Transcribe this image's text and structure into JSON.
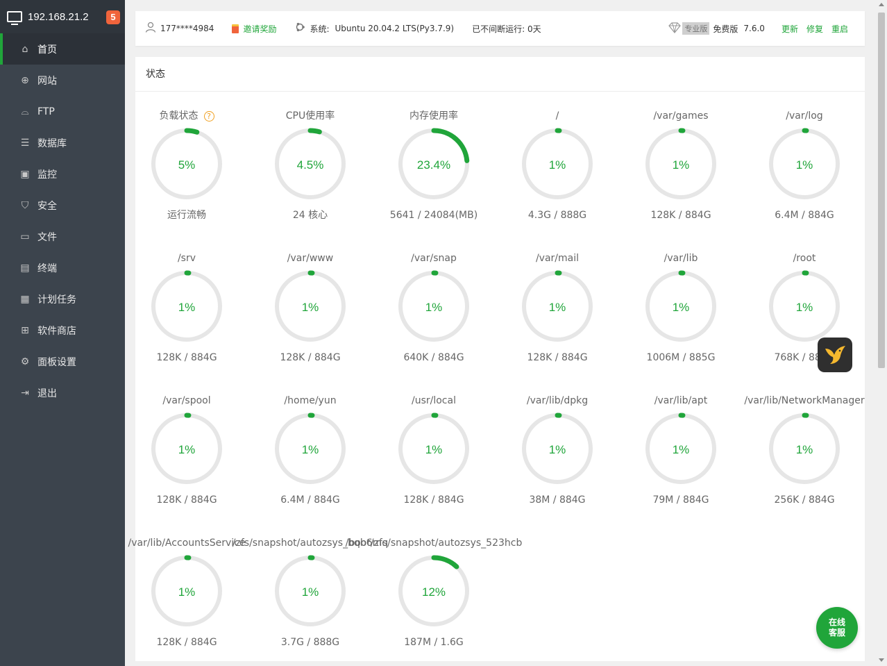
{
  "sidebar": {
    "host": "192.168.21.2",
    "badge": "5",
    "items": [
      {
        "label": "首页",
        "icon": "home-icon",
        "glyph": "⌂",
        "active": true
      },
      {
        "label": "网站",
        "icon": "globe-icon",
        "glyph": "⊕",
        "active": false
      },
      {
        "label": "FTP",
        "icon": "ftp-icon",
        "glyph": "⌓",
        "active": false
      },
      {
        "label": "数据库",
        "icon": "database-icon",
        "glyph": "☰",
        "active": false
      },
      {
        "label": "监控",
        "icon": "monitor-icon",
        "glyph": "▣",
        "active": false
      },
      {
        "label": "安全",
        "icon": "shield-icon",
        "glyph": "⛉",
        "active": false
      },
      {
        "label": "文件",
        "icon": "folder-icon",
        "glyph": "▭",
        "active": false
      },
      {
        "label": "终端",
        "icon": "terminal-icon",
        "glyph": "▤",
        "active": false
      },
      {
        "label": "计划任务",
        "icon": "calendar-icon",
        "glyph": "▦",
        "active": false
      },
      {
        "label": "软件商店",
        "icon": "apps-icon",
        "glyph": "⊞",
        "active": false
      },
      {
        "label": "面板设置",
        "icon": "gear-icon",
        "glyph": "⚙",
        "active": false
      },
      {
        "label": "退出",
        "icon": "logout-icon",
        "glyph": "⇥",
        "active": false
      }
    ]
  },
  "topbar": {
    "user": "177****4984",
    "invite": "邀请奖励",
    "system_label": "系统:",
    "system_value": "Ubuntu 20.04.2 LTS(Py3.7.9)",
    "uptime": "已不间断运行: 0天",
    "pro_tag": "专业版",
    "free_label": "免费版",
    "version": "7.6.0",
    "update": "更新",
    "repair": "修复",
    "restart": "重启"
  },
  "status": {
    "title": "状态",
    "help": "?"
  },
  "gauges": [
    {
      "title": "负载状态",
      "value": "5%",
      "percent": 5,
      "sub": "运行流畅",
      "help": true
    },
    {
      "title": "CPU使用率",
      "value": "4.5%",
      "percent": 4.5,
      "sub": "24 核心"
    },
    {
      "title": "内存使用率",
      "value": "23.4%",
      "percent": 23.4,
      "sub": "5641 / 24084(MB)"
    },
    {
      "title": "/",
      "value": "1%",
      "percent": 1,
      "sub": "4.3G / 888G"
    },
    {
      "title": "/var/games",
      "value": "1%",
      "percent": 1,
      "sub": "128K / 884G"
    },
    {
      "title": "/var/log",
      "value": "1%",
      "percent": 1,
      "sub": "6.4M / 884G"
    },
    {
      "title": "/srv",
      "value": "1%",
      "percent": 1,
      "sub": "128K / 884G"
    },
    {
      "title": "/var/www",
      "value": "1%",
      "percent": 1,
      "sub": "128K / 884G"
    },
    {
      "title": "/var/snap",
      "value": "1%",
      "percent": 1,
      "sub": "640K / 884G"
    },
    {
      "title": "/var/mail",
      "value": "1%",
      "percent": 1,
      "sub": "128K / 884G"
    },
    {
      "title": "/var/lib",
      "value": "1%",
      "percent": 1,
      "sub": "1006M / 885G"
    },
    {
      "title": "/root",
      "value": "1%",
      "percent": 1,
      "sub": "768K / 884G"
    },
    {
      "title": "/var/spool",
      "value": "1%",
      "percent": 1,
      "sub": "128K / 884G"
    },
    {
      "title": "/home/yun",
      "value": "1%",
      "percent": 1,
      "sub": "6.4M / 884G"
    },
    {
      "title": "/usr/local",
      "value": "1%",
      "percent": 1,
      "sub": "128K / 884G"
    },
    {
      "title": "/var/lib/dpkg",
      "value": "1%",
      "percent": 1,
      "sub": "38M / 884G"
    },
    {
      "title": "/var/lib/apt",
      "value": "1%",
      "percent": 1,
      "sub": "79M / 884G"
    },
    {
      "title": "/var/lib/NetworkManager",
      "value": "1%",
      "percent": 1,
      "sub": "256K / 884G"
    },
    {
      "title": "/var/lib/AccountsService",
      "value": "1%",
      "percent": 1,
      "sub": "128K / 884G"
    },
    {
      "title": "/zfs/snapshot/autozsys_bqb6mq",
      "value": "1%",
      "percent": 1,
      "sub": "3.7G / 888G"
    },
    {
      "title": "/boot/zfs/snapshot/autozsys_523hcb",
      "value": "12%",
      "percent": 12,
      "sub": "187M / 1.6G"
    }
  ],
  "colors": {
    "accent": "#20a53a",
    "track": "#e6e6e6",
    "sidebar_bg": "#3c444d",
    "badge": "#f0643c"
  },
  "chat": {
    "line1": "在线",
    "line2": "客服"
  }
}
